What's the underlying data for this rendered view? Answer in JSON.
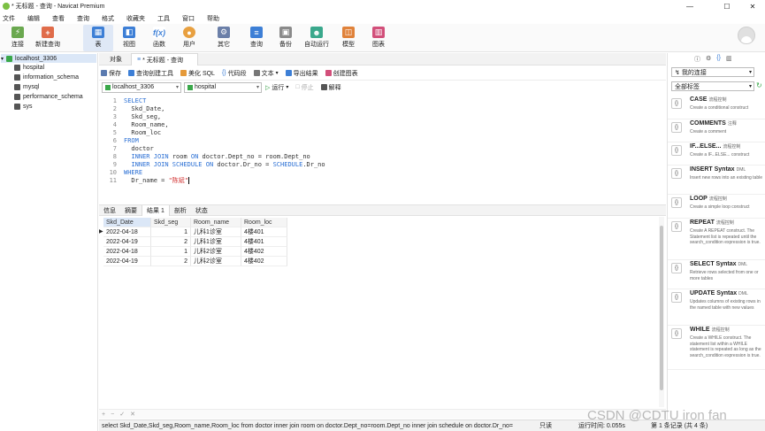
{
  "window": {
    "title": "* 无标题 - 查询 - Navicat Premium",
    "min": "—",
    "max": "☐",
    "close": "✕"
  },
  "menu": [
    "文件",
    "编辑",
    "查看",
    "查询",
    "格式",
    "收藏夹",
    "工具",
    "窗口",
    "帮助"
  ],
  "ribbon": {
    "connect": "连接",
    "new_query": "新建查询",
    "table": "表",
    "view": "视图",
    "function": "函数",
    "user": "用户",
    "other": "其它",
    "query": "查询",
    "backup": "备份",
    "autorun": "自动运行",
    "model": "模型",
    "chart": "图表"
  },
  "tree": {
    "connection": "localhost_3306",
    "databases": [
      "hospital",
      "information_schema",
      "mysql",
      "performance_schema",
      "sys"
    ]
  },
  "tabs": {
    "objects": "对象",
    "query_tab": "* 无标题 - 查询"
  },
  "query_toolbar": {
    "save": "保存",
    "builder": "查询创建工具",
    "beautify": "美化 SQL",
    "snippet": "代码段",
    "text": "文本",
    "export": "导出结果",
    "create_chart": "创建图表"
  },
  "selectors": {
    "connection": "localhost_3306",
    "database": "hospital",
    "run": "运行",
    "stop": "停止",
    "explain": "解释"
  },
  "sql_lines": [
    [
      [
        "kw",
        "SELECT"
      ]
    ],
    [
      [
        "",
        "  Skd_Date,"
      ]
    ],
    [
      [
        "",
        "  Skd_seg,"
      ]
    ],
    [
      [
        "",
        "  Room_name,"
      ]
    ],
    [
      [
        "",
        "  Room_loc"
      ]
    ],
    [
      [
        "kw",
        "FROM"
      ]
    ],
    [
      [
        "",
        "  doctor"
      ]
    ],
    [
      [
        "",
        "  "
      ],
      [
        "kw",
        "INNER JOIN"
      ],
      [
        "",
        " room "
      ],
      [
        "kw",
        "ON"
      ],
      [
        "",
        " doctor.Dept_no = room.Dept_no"
      ]
    ],
    [
      [
        "",
        "  "
      ],
      [
        "kw",
        "INNER JOIN SCHEDULE ON"
      ],
      [
        "",
        " doctor.Dr_no = "
      ],
      [
        "kw",
        "SCHEDULE"
      ],
      [
        "",
        ".Dr_no"
      ]
    ],
    [
      [
        "kw",
        "WHERE"
      ]
    ],
    [
      [
        "",
        "  Dr_name = "
      ],
      [
        "str",
        "\"陈斌\""
      ]
    ]
  ],
  "result_tabs": [
    "信息",
    "摘要",
    "结果 1",
    "剖析",
    "状态"
  ],
  "grid": {
    "columns": [
      "Skd_Date",
      "Skd_seg",
      "Room_name",
      "Room_loc"
    ],
    "rows": [
      [
        "2022-04-18",
        "1",
        "儿科1诊室",
        "4楼401"
      ],
      [
        "2022-04-19",
        "2",
        "儿科1诊室",
        "4楼401"
      ],
      [
        "2022-04-18",
        "1",
        "儿科2诊室",
        "4楼402"
      ],
      [
        "2022-04-19",
        "2",
        "儿科2诊室",
        "4楼402"
      ]
    ]
  },
  "grid_footer": [
    "+",
    "−",
    "✓",
    "✕"
  ],
  "status": {
    "sql": "select Skd_Date,Skd_seg,Room_name,Room_loc from doctor inner join room on doctor.Dept_no=room.Dept_no inner join schedule on doctor.Dr_no=",
    "mode": "只读",
    "time": "运行时间: 0.055s",
    "records": "第 1 条记录 (共 4 条)"
  },
  "right_panel": {
    "conn_select": "我的连接",
    "tag_select": "全部标签",
    "snippets": [
      {
        "title": "CASE",
        "tag": "流程控制",
        "desc": "Create a conditional construct"
      },
      {
        "title": "COMMENTS",
        "tag": "注释",
        "desc": "Create a comment"
      },
      {
        "title": "IF...ELSE...",
        "tag": "流程控制",
        "desc": "Create a IF...ELSE... construct"
      },
      {
        "title": "INSERT Syntax",
        "tag": "DML",
        "desc": "Insert new rows into an existing table"
      },
      {
        "title": "LOOP",
        "tag": "流程控制",
        "desc": "Create a simple loop construct"
      },
      {
        "title": "REPEAT",
        "tag": "流程控制",
        "desc": "Create A REPEAT construct. The Statement list is repeated until the search_condition expression is true."
      },
      {
        "title": "SELECT Syntax",
        "tag": "DML",
        "desc": "Retrieve rows selected from one or more tables"
      },
      {
        "title": "UPDATE Syntax",
        "tag": "DML",
        "desc": "Updates columns of existing rows in the named table with new values"
      },
      {
        "title": "WHILE",
        "tag": "流程控制",
        "desc": "Create a WHILE construct. The statement list within a WHILE statement is repeated as long as the search_condition expression is true."
      }
    ]
  },
  "watermark": "CSDN @CDTU iron fan"
}
